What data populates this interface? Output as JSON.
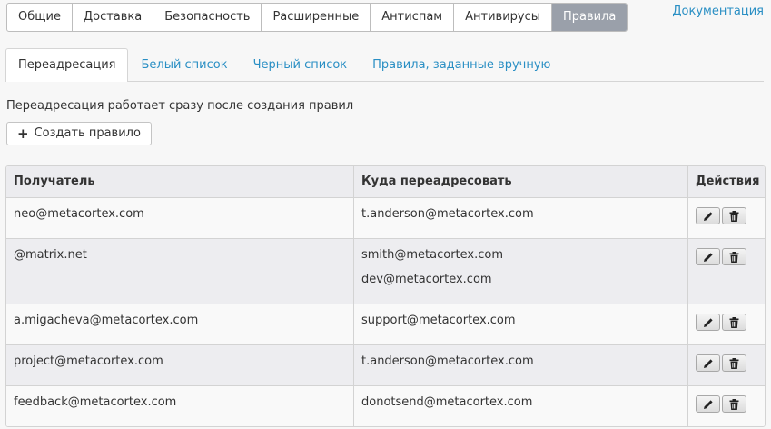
{
  "topnav": {
    "items": [
      "Общие",
      "Доставка",
      "Безопасность",
      "Расширенные",
      "Антиспам",
      "Антивирусы",
      "Правила"
    ],
    "active": "Правила"
  },
  "doc_link": "Документация",
  "subtabs": [
    "Переадресация",
    "Белый список",
    "Черный список",
    "Правила, заданные вручную"
  ],
  "note": "Переадресация работает сразу после создания правил",
  "create_button": "Создать правило",
  "table": {
    "headers": [
      "Получатель",
      "Куда переадресовать",
      "Действия"
    ],
    "rows": [
      {
        "recipient": "neo@metacortex.com",
        "targets": [
          "t.anderson@metacortex.com"
        ]
      },
      {
        "recipient": "@matrix.net",
        "targets": [
          "smith@metacortex.com",
          "dev@metacortex.com"
        ]
      },
      {
        "recipient": "a.migacheva@metacortex.com",
        "targets": [
          "support@metacortex.com"
        ]
      },
      {
        "recipient": "project@metacortex.com",
        "targets": [
          "t.anderson@metacortex.com"
        ]
      },
      {
        "recipient": "feedback@metacortex.com",
        "targets": [
          "donotsend@metacortex.com"
        ]
      }
    ]
  },
  "icons": {
    "edit": "pencil-icon",
    "delete": "trash-icon",
    "add": "plus-icon"
  },
  "colors": {
    "link": "#2a8fc4",
    "active_tab": "#9aa0aa"
  }
}
